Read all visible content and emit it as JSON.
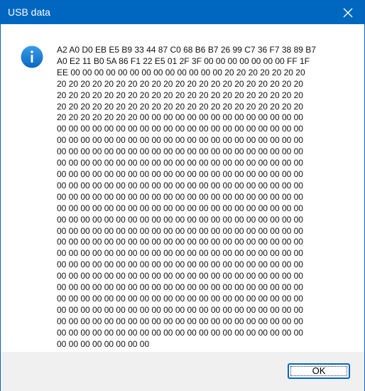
{
  "window": {
    "title": "USB data"
  },
  "dialog": {
    "icon": "info-icon",
    "message_lines": [
      "A2 A0 D0 EB E5 B9 33 44 87 C0 68 B6 B7 26 99 C7 36 F7 38 89 B7",
      "A0 E2 11 B0 5A 86 F1 22 E5 01 2F 3F 00 00 00 00 00 00 00 FF 1F",
      "EE 00 00 00 00 00 00 00 00 00 00 00 00 00 20 20 20 20 20 20 20",
      "20 20 20 20 20 20 20 20 20 20 20 20 20 20 20 20 20 20 20 20 20",
      "20 20 20 20 20 20 20 20 20 20 20 20 20 20 20 20 20 20 20 20 20",
      "20 20 20 20 20 20 20 20 20 20 20 20 20 20 20 20 20 20 20 20 20",
      "20 20 20 20 20 20 20 00 00 00 00 00 00 00 00 00 00 00 00 00 00",
      "00 00 00 00 00 00 00 00 00 00 00 00 00 00 00 00 00 00 00 00 00",
      "00 00 00 00 00 00 00 00 00 00 00 00 00 00 00 00 00 00 00 00 00",
      "00 00 00 00 00 00 00 00 00 00 00 00 00 00 00 00 00 00 00 00 00",
      "00 00 00 00 00 00 00 00 00 00 00 00 00 00 00 00 00 00 00 00 00",
      "00 00 00 00 00 00 00 00 00 00 00 00 00 00 00 00 00 00 00 00 00",
      "00 00 00 00 00 00 00 00 00 00 00 00 00 00 00 00 00 00 00 00 00",
      "00 00 00 00 00 00 00 00 00 00 00 00 00 00 00 00 00 00 00 00 00",
      "00 00 00 00 00 00 00 00 00 00 00 00 00 00 00 00 00 00 00 00 00",
      "00 00 00 00 00 00 00 00 00 00 00 00 00 00 00 00 00 00 00 00 00",
      "00 00 00 00 00 00 00 00 00 00 00 00 00 00 00 00 00 00 00 00 00",
      "00 00 00 00 00 00 00 00 00 00 00 00 00 00 00 00 00 00 00 00 00",
      "00 00 00 00 00 00 00 00 00 00 00 00 00 00 00 00 00 00 00 00 00",
      "00 00 00 00 00 00 00 00 00 00 00 00 00 00 00 00 00 00 00 00 00",
      "00 00 00 00 00 00 00 00 00 00 00 00 00 00 00 00 00 00 00 00 00",
      "00 00 00 00 00 00 00 00 00 00 00 00 00 00 00 00 00 00 00 00 00",
      "00 00 00 00 00 00 00 00 00 00 00 00 00 00 00 00 00 00 00 00 00",
      "00 00 00 00 00 00 00 00 00 00 00 00 00 00 00 00 00 00 00 00 00",
      "00 00 00 00 00 00 00 00 00 00 00 00 00 00 00 00 00 00 00 00 00",
      "00 00 00 00 00 00 00 00 00 00 00 00 00 00 00 00 00 00 00 00 00",
      "00 00 00 00 00 00 00 00"
    ],
    "ok_label": "OK"
  },
  "colors": {
    "titlebar": "#0067c0",
    "footer": "#f0f0f0",
    "icon": "#1a7fd4"
  }
}
